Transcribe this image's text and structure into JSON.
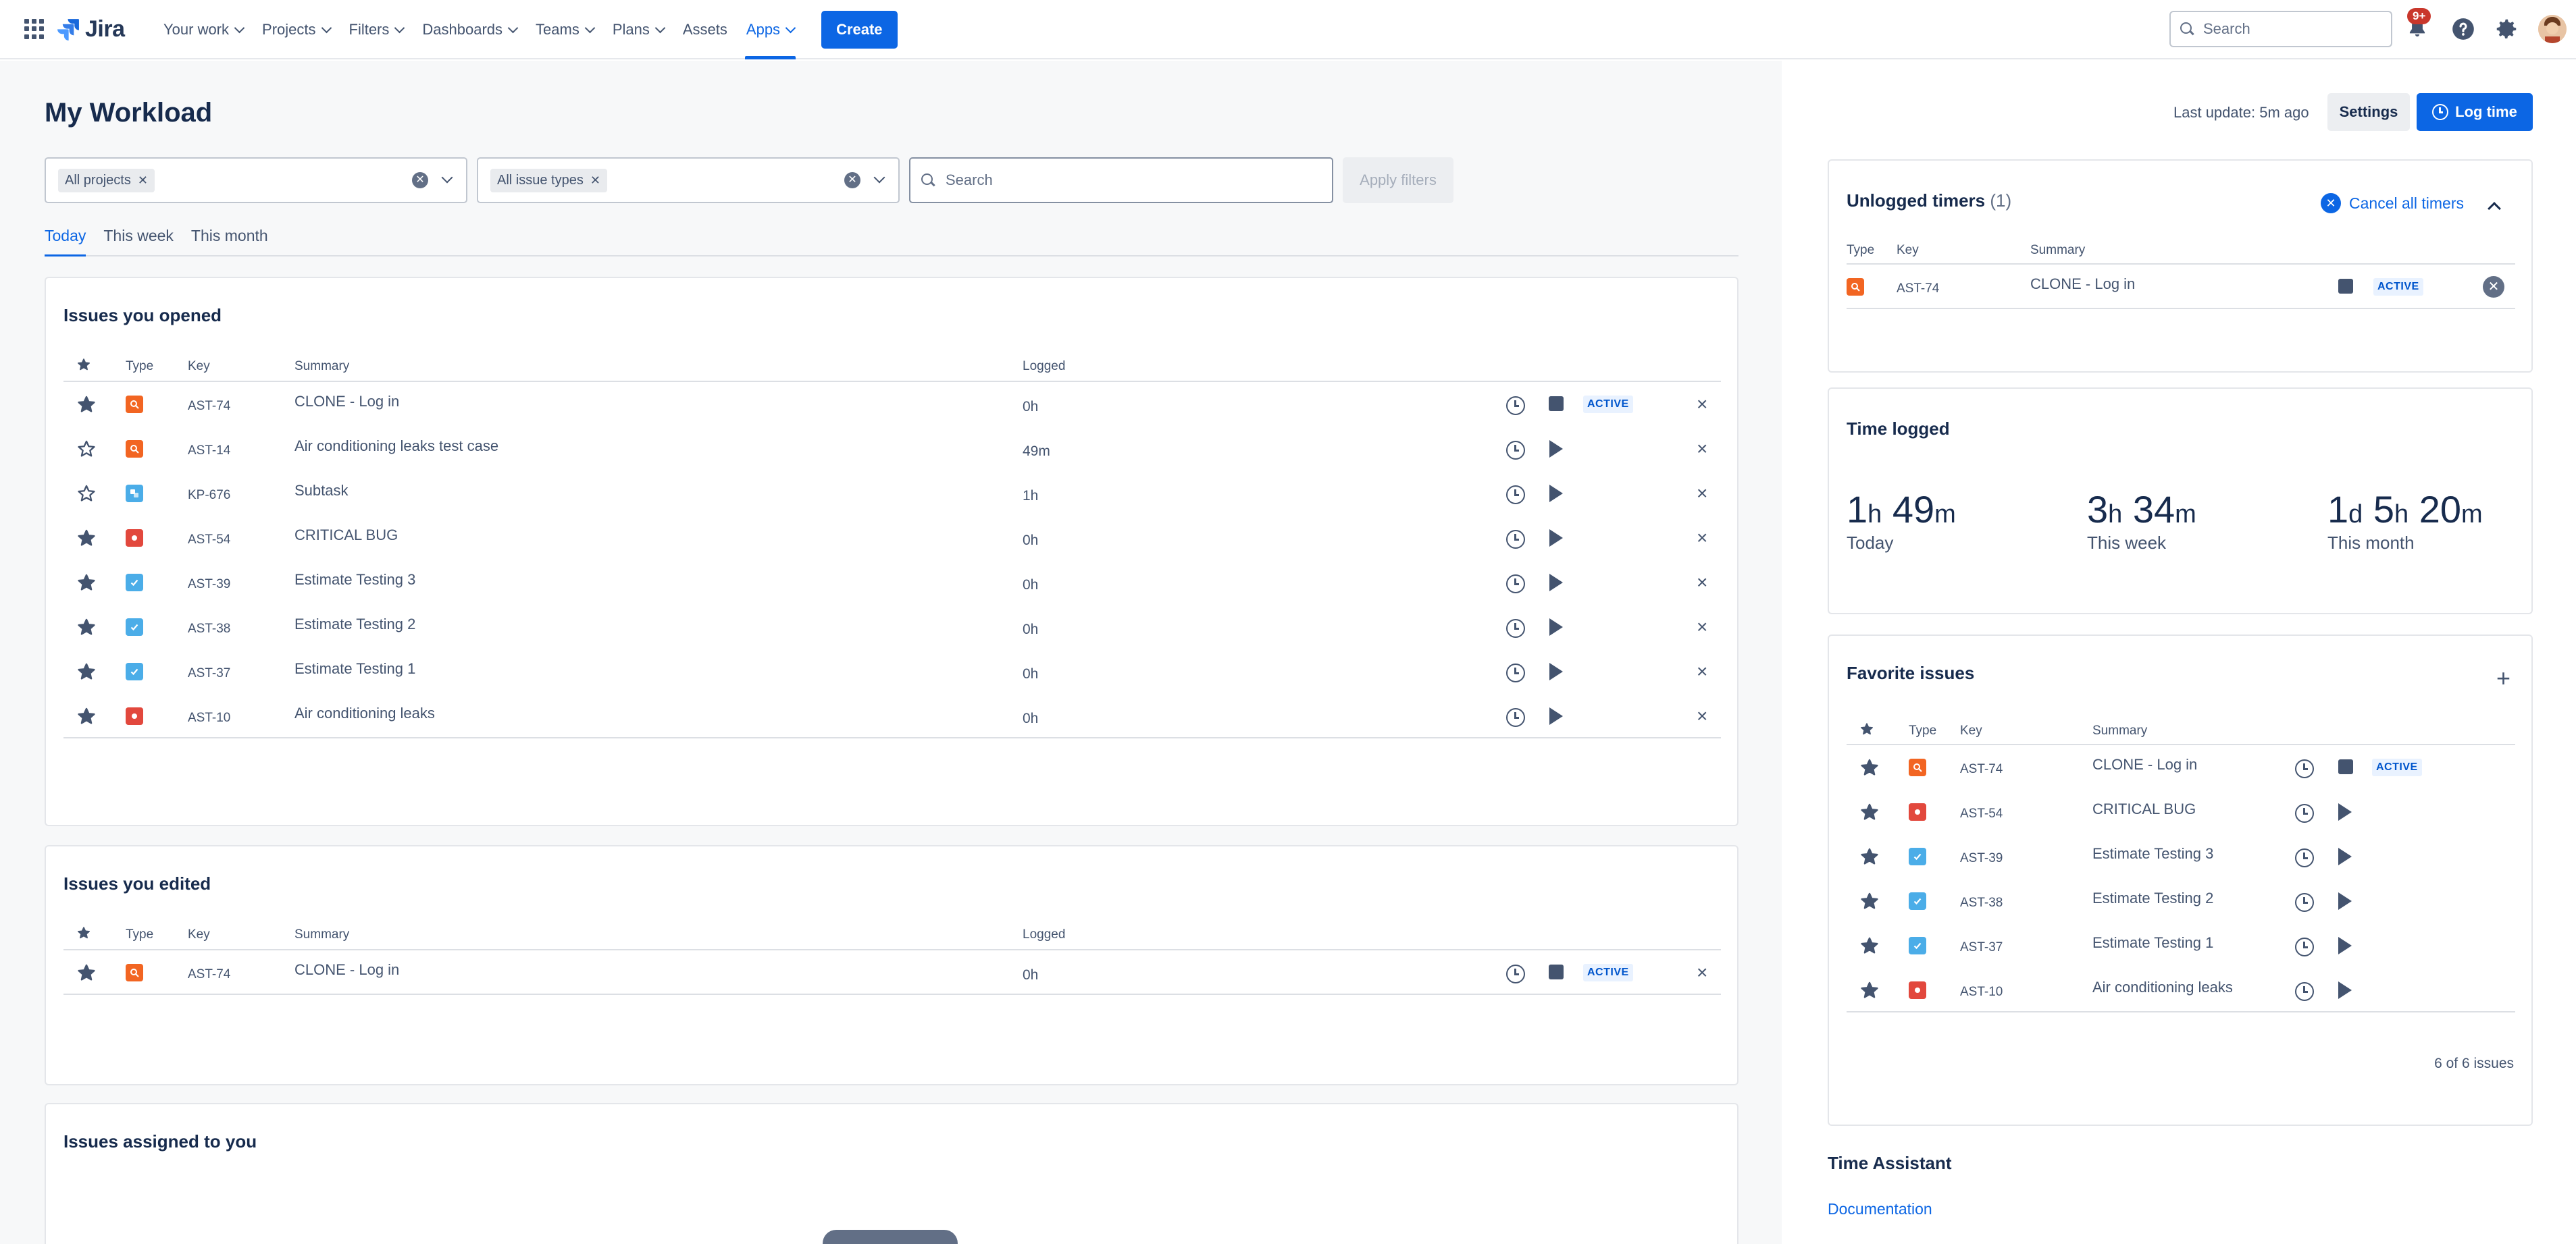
{
  "nav": {
    "brand": "Jira",
    "items": [
      {
        "label": "Your work",
        "dropdown": true,
        "active": false
      },
      {
        "label": "Projects",
        "dropdown": true,
        "active": false
      },
      {
        "label": "Filters",
        "dropdown": true,
        "active": false
      },
      {
        "label": "Dashboards",
        "dropdown": true,
        "active": false
      },
      {
        "label": "Teams",
        "dropdown": true,
        "active": false
      },
      {
        "label": "Plans",
        "dropdown": true,
        "active": false
      },
      {
        "label": "Assets",
        "dropdown": false,
        "active": false
      },
      {
        "label": "Apps",
        "dropdown": true,
        "active": true
      }
    ],
    "create_label": "Create",
    "search_placeholder": "Search",
    "notification_badge": "9+"
  },
  "page": {
    "title": "My Workload",
    "filters": {
      "projects_chip": "All projects",
      "issue_types_chip": "All issue types",
      "search_placeholder": "Search",
      "apply_label": "Apply filters"
    },
    "tabs": [
      "Today",
      "This week",
      "This month"
    ],
    "active_tab": "Today"
  },
  "columns": {
    "type": "Type",
    "key": "Key",
    "summary": "Summary",
    "logged": "Logged"
  },
  "status_label": "ACTIVE",
  "opened": {
    "title": "Issues you opened",
    "rows": [
      {
        "starred": true,
        "type": "test-case",
        "key": "AST-74",
        "summary": "CLONE - Log in",
        "logged": "0h",
        "active": true
      },
      {
        "starred": false,
        "type": "test-case",
        "key": "AST-14",
        "summary": "Air conditioning leaks test case",
        "logged": "49m",
        "active": false
      },
      {
        "starred": false,
        "type": "subtask",
        "key": "KP-676",
        "summary": "Subtask",
        "logged": "1h",
        "active": false
      },
      {
        "starred": true,
        "type": "bug",
        "key": "AST-54",
        "summary": "CRITICAL BUG",
        "logged": "0h",
        "active": false
      },
      {
        "starred": true,
        "type": "task",
        "key": "AST-39",
        "summary": "Estimate Testing 3",
        "logged": "0h",
        "active": false
      },
      {
        "starred": true,
        "type": "task",
        "key": "AST-38",
        "summary": "Estimate Testing 2",
        "logged": "0h",
        "active": false
      },
      {
        "starred": true,
        "type": "task",
        "key": "AST-37",
        "summary": "Estimate Testing 1",
        "logged": "0h",
        "active": false
      },
      {
        "starred": true,
        "type": "bug",
        "key": "AST-10",
        "summary": "Air conditioning leaks",
        "logged": "0h",
        "active": false
      }
    ]
  },
  "edited": {
    "title": "Issues you edited",
    "rows": [
      {
        "starred": true,
        "type": "test-case",
        "key": "AST-74",
        "summary": "CLONE - Log in",
        "logged": "0h",
        "active": true
      }
    ]
  },
  "assigned": {
    "title": "Issues assigned to you"
  },
  "right": {
    "last_update": "Last update: 5m ago",
    "settings_label": "Settings",
    "log_time_label": "Log time",
    "unlogged": {
      "title": "Unlogged timers",
      "count": "(1)",
      "cancel_all": "Cancel all timers",
      "rows": [
        {
          "type": "test-case",
          "key": "AST-74",
          "summary": "CLONE - Log in",
          "active": true
        }
      ]
    },
    "time_logged": {
      "title": "Time logged",
      "blocks": [
        {
          "parts": [
            [
              "1",
              "h"
            ],
            [
              "49",
              "m"
            ]
          ],
          "label": "Today"
        },
        {
          "parts": [
            [
              "3",
              "h"
            ],
            [
              "34",
              "m"
            ]
          ],
          "label": "This week"
        },
        {
          "parts": [
            [
              "1",
              "d"
            ],
            [
              "5",
              "h"
            ],
            [
              "20",
              "m"
            ]
          ],
          "label": "This month"
        }
      ]
    },
    "favorites": {
      "title": "Favorite issues",
      "rows": [
        {
          "type": "test-case",
          "key": "AST-74",
          "summary": "CLONE - Log in",
          "active": true
        },
        {
          "type": "bug",
          "key": "AST-54",
          "summary": "CRITICAL BUG",
          "active": false
        },
        {
          "type": "task",
          "key": "AST-39",
          "summary": "Estimate Testing 3",
          "active": false
        },
        {
          "type": "task",
          "key": "AST-38",
          "summary": "Estimate Testing 2",
          "active": false
        },
        {
          "type": "task",
          "key": "AST-37",
          "summary": "Estimate Testing 1",
          "active": false
        },
        {
          "type": "bug",
          "key": "AST-10",
          "summary": "Air conditioning leaks",
          "active": false
        }
      ],
      "pager": "6 of 6 issues"
    },
    "assistant_title": "Time Assistant",
    "documentation_link": "Documentation"
  },
  "colors": {
    "primary": "#0c66e4",
    "test_case": "#f26522",
    "bug": "#e2483d",
    "task": "#4bade8",
    "text": "#172b4d",
    "muted": "#44546f"
  }
}
